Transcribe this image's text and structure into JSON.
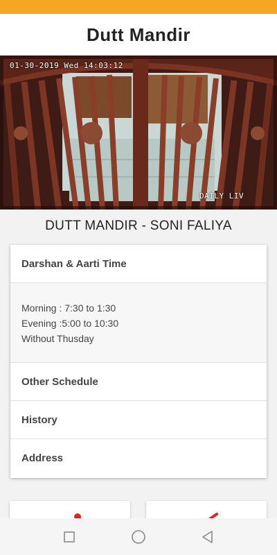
{
  "header": {
    "title": "Dutt Mandir"
  },
  "camera": {
    "timestamp": "01-30-2019 Wed 14:03:12",
    "watermark": "DAILY LIV"
  },
  "temple_name": "DUTT MANDIR - SONI FALIYA",
  "accordion": [
    {
      "title": "Darshan & Aarti Time",
      "expanded": true,
      "lines": [
        "Morning : 7:30 to 1:30",
        "Evening :5:00 to 10:30",
        "Without Thusday"
      ]
    },
    {
      "title": "Other Schedule",
      "expanded": false
    },
    {
      "title": "History",
      "expanded": false
    },
    {
      "title": "Address",
      "expanded": false
    }
  ],
  "nav": {
    "icons": [
      "square-icon",
      "circle-icon",
      "back-triangle-icon"
    ]
  },
  "colors": {
    "status_bar": "#f6a623",
    "accent_red": "#e0231f"
  }
}
